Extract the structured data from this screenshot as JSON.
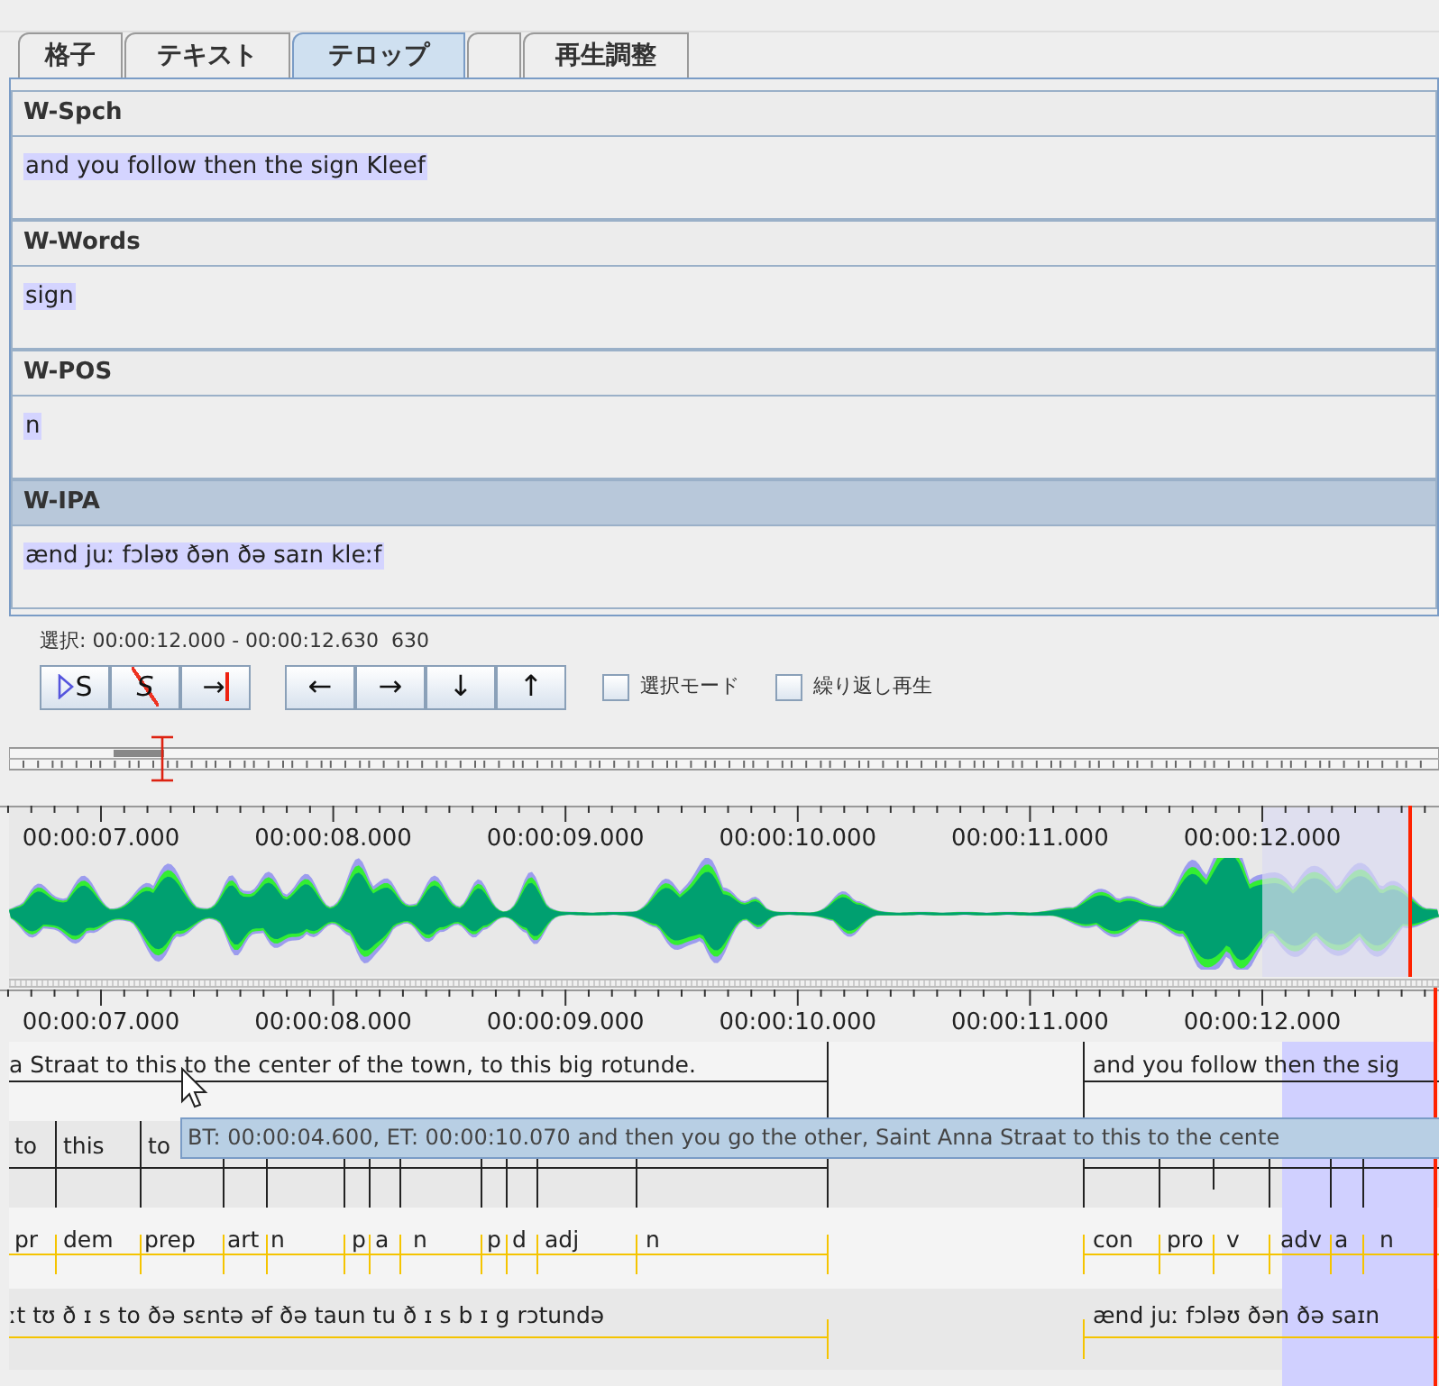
{
  "tabs": [
    {
      "kind": "label",
      "label": "格子",
      "selected": false
    },
    {
      "kind": "label",
      "label": "テキスト",
      "selected": false
    },
    {
      "kind": "label",
      "label": "テロップ",
      "selected": true
    },
    {
      "kind": "blank",
      "selected": false
    },
    {
      "kind": "label",
      "label": "再生調整",
      "selected": false
    }
  ],
  "subtitle_tiers": [
    {
      "name": "W-Spch",
      "value": "and you follow then the sign Kleef",
      "selected": false
    },
    {
      "name": "W-Words",
      "value": "sign",
      "selected": false
    },
    {
      "name": "W-POS",
      "value": "n",
      "selected": false
    },
    {
      "name": "W-IPA",
      "value": "ænd juː fɔləʊ ðən ðə saɪn kleːf",
      "selected": true
    }
  ],
  "selection_info": "選択: 00:00:12.000 - 00:00:12.630  630",
  "play_buttons": [
    {
      "kind": "play-selection",
      "label": "S"
    },
    {
      "kind": "clear-selection",
      "label": "S"
    },
    {
      "kind": "to-end",
      "label": "→"
    }
  ],
  "nav_buttons": [
    "←",
    "→",
    "↓",
    "↑"
  ],
  "checkboxes": [
    {
      "label": "選択モード",
      "checked": false
    },
    {
      "label": "繰り返し再生",
      "checked": false
    }
  ],
  "ruler_top": [
    "00:00:07.000",
    "00:00:08.000",
    "00:00:09.000",
    "00:00:10.000",
    "00:00:11.000",
    "00:00:12.000"
  ],
  "ruler_bottom": [
    "00:00:07.000",
    "00:00:08.000",
    "00:00:09.000",
    "00:00:10.000",
    "00:00:11.000",
    "00:00:12.000"
  ],
  "timeline_tiers": [
    {
      "kind": "speech",
      "annotations": [
        "a Straat to this to the center of the town, to this big rotunde.",
        "and you follow then the sig"
      ]
    },
    {
      "kind": "words",
      "annotations": [
        "to",
        "this",
        "to"
      ]
    },
    {
      "kind": "pos",
      "annotations": [
        "pr",
        "dem",
        "prep",
        "art",
        "n",
        "p",
        "a",
        "n",
        "p",
        "d",
        "adj",
        "n",
        "con",
        "pro",
        "v",
        "adv",
        "a",
        "n"
      ]
    },
    {
      "kind": "ipa",
      "annotations": [
        "ːt tʊ ð ɪ s to ðə sɛntə əf ðə taun tu ð ɪ s b ɪ g rɔtundə",
        "ænd juː fɔləʊ ðən ðə saɪn"
      ]
    }
  ],
  "tooltip": "BT: 00:00:04.600, ET: 00:00:10.070 and then you go the other, Saint Anna Straat to this to the cente"
}
